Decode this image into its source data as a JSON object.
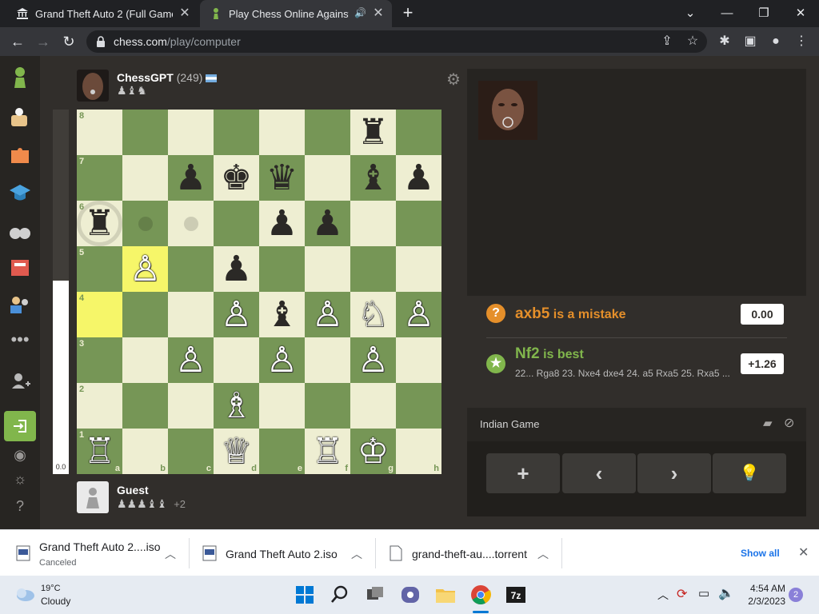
{
  "browser": {
    "tabs": [
      {
        "title": "Grand Theft Auto 2 (Full Game) :",
        "favicon": "museum-icon"
      },
      {
        "title": "Play Chess Online Against th",
        "favicon": "pawn-icon",
        "audio": "speaker-icon"
      }
    ],
    "url_host": "chess.com",
    "url_path": "/play/computer"
  },
  "game": {
    "opponent": {
      "name": "ChessGPT",
      "rating": "(249)",
      "flag": "Argentina",
      "captured": "♟♝♞"
    },
    "player": {
      "name": "Guest",
      "captured": "♟♟♟♝♝",
      "advantage": "+2"
    },
    "eval_bar_value": "0.0",
    "eval_white_fraction": 0.53,
    "board": {
      "ranks": [
        "8",
        "7",
        "6",
        "5",
        "4",
        "3",
        "2",
        "1"
      ],
      "files": [
        "a",
        "b",
        "c",
        "d",
        "e",
        "f",
        "g",
        "h"
      ],
      "pieces": [
        {
          "sq": "g8",
          "glyph": "♜",
          "color": "black"
        },
        {
          "sq": "c7",
          "glyph": "♟",
          "color": "black"
        },
        {
          "sq": "d7",
          "glyph": "♚",
          "color": "black"
        },
        {
          "sq": "e7",
          "glyph": "♛",
          "color": "black"
        },
        {
          "sq": "g7",
          "glyph": "♝",
          "color": "black"
        },
        {
          "sq": "h7",
          "glyph": "♟",
          "color": "black"
        },
        {
          "sq": "a6",
          "glyph": "♜",
          "color": "black"
        },
        {
          "sq": "e6",
          "glyph": "♟",
          "color": "black"
        },
        {
          "sq": "f6",
          "glyph": "♟",
          "color": "black"
        },
        {
          "sq": "b5",
          "glyph": "♙",
          "color": "white"
        },
        {
          "sq": "d5",
          "glyph": "♟",
          "color": "black"
        },
        {
          "sq": "d4",
          "glyph": "♙",
          "color": "white"
        },
        {
          "sq": "e4",
          "glyph": "♝",
          "color": "black"
        },
        {
          "sq": "f4",
          "glyph": "♙",
          "color": "white"
        },
        {
          "sq": "g4",
          "glyph": "♘",
          "color": "white"
        },
        {
          "sq": "h4",
          "glyph": "♙",
          "color": "white"
        },
        {
          "sq": "c3",
          "glyph": "♙",
          "color": "white"
        },
        {
          "sq": "e3",
          "glyph": "♙",
          "color": "white"
        },
        {
          "sq": "g3",
          "glyph": "♙",
          "color": "white"
        },
        {
          "sq": "d2",
          "glyph": "♗",
          "color": "white"
        },
        {
          "sq": "a1",
          "glyph": "♖",
          "color": "white"
        },
        {
          "sq": "d1",
          "glyph": "♕",
          "color": "white"
        },
        {
          "sq": "f1",
          "glyph": "♖",
          "color": "white"
        },
        {
          "sq": "g1",
          "glyph": "♔",
          "color": "white"
        }
      ],
      "highlighted": [
        "b5",
        "a4"
      ],
      "move_hints": [
        "b6",
        "c6"
      ],
      "capture_hints": [
        "a6"
      ]
    }
  },
  "coach": {
    "mistake_move": "axb5",
    "mistake_text": "is a mistake",
    "mistake_eval": "0.00",
    "best_move": "Nf2",
    "best_text": "is best",
    "best_eval": "+1.26",
    "best_line": "22... Rga8 23. Nxe4 dxe4 24. a5 Rxa5 25. Rxa5 ...",
    "opening": "Indian Game",
    "controls": [
      "+",
      "‹",
      "›",
      "💡"
    ]
  },
  "downloads": {
    "items": [
      {
        "name": "Grand Theft Auto 2....iso",
        "status": "Canceled"
      },
      {
        "name": "Grand Theft Auto 2.iso",
        "status": ""
      },
      {
        "name": "grand-theft-au....torrent",
        "status": ""
      }
    ],
    "show_all": "Show all"
  },
  "taskbar": {
    "weather_temp": "19°C",
    "weather_desc": "Cloudy",
    "time": "4:54 AM",
    "date": "2/3/2023",
    "notifications": "2"
  },
  "colors": {
    "board_light": "#eeeed2",
    "board_dark": "#769656",
    "highlight": "#f6f669",
    "mistake": "#e58f2a",
    "best": "#81b64c"
  }
}
